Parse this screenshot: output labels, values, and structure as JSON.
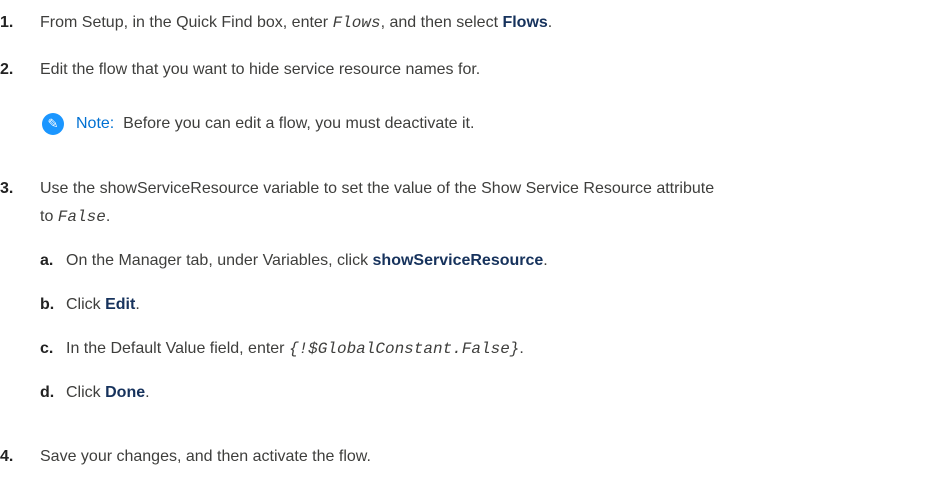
{
  "steps": [
    {
      "num": "1.",
      "pre": "From Setup, in the Quick Find box, enter ",
      "code": "Flows",
      "mid": ", and then select ",
      "bold": "Flows",
      "post": "."
    },
    {
      "num": "2.",
      "text": "Edit the flow that you want to hide service resource names for."
    },
    {
      "num": "3.",
      "line1": "Use the showServiceResource variable to set the value of the Show Service Resource attribute",
      "line2_pre": "to ",
      "line2_code": "False",
      "line2_post": "."
    },
    {
      "num": "4.",
      "text": "Save your changes, and then activate the flow."
    }
  ],
  "note": {
    "icon": "edit-icon",
    "label": "Note:",
    "text": "Before you can edit a flow, you must deactivate it."
  },
  "substeps": [
    {
      "letter": "a.",
      "pre": "On the Manager tab, under Variables, click ",
      "bold": "showServiceResource",
      "post": "."
    },
    {
      "letter": "b.",
      "pre": "Click ",
      "bold": "Edit",
      "post": "."
    },
    {
      "letter": "c.",
      "pre": "In the Default Value field, enter ",
      "code": "{!$GlobalConstant.False}",
      "post": "."
    },
    {
      "letter": "d.",
      "pre": "Click ",
      "bold": "Done",
      "post": "."
    }
  ],
  "colors": {
    "accent": "#1b96ff",
    "note_label": "#0070d2",
    "bold_text": "#16325c"
  }
}
